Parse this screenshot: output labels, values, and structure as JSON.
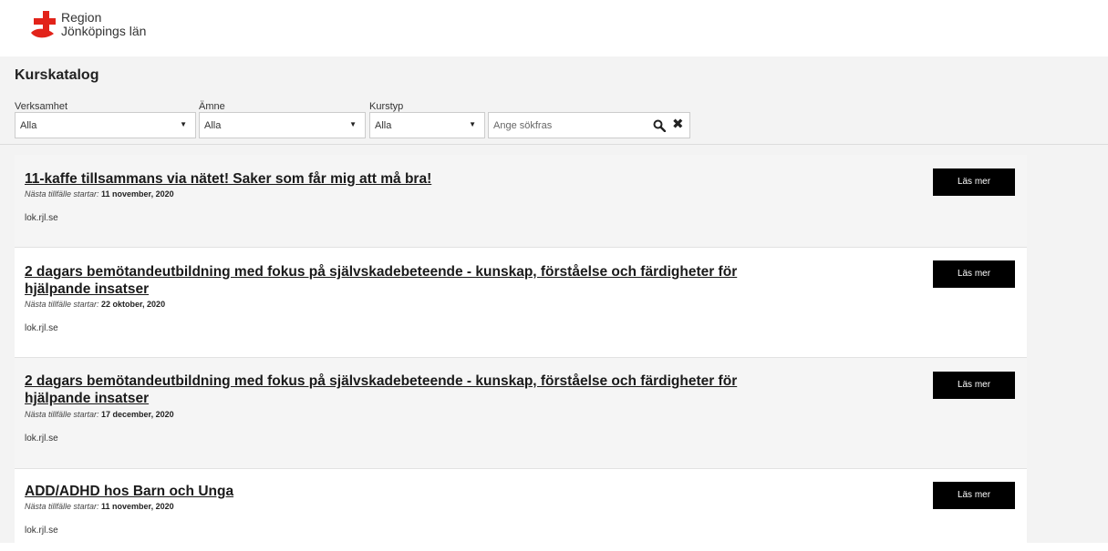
{
  "brand": {
    "line1": "Region",
    "line2": "Jönköpings län",
    "accent": "#e2231a"
  },
  "page_title": "Kurskatalog",
  "filters": [
    {
      "label": "Verksamhet",
      "value": "Alla"
    },
    {
      "label": "Ämne",
      "value": "Alla"
    },
    {
      "label": "Kurstyp",
      "value": "Alla"
    }
  ],
  "search": {
    "placeholder": "Ange sökfras",
    "search_icon": "search-icon",
    "clear_icon": "close-icon"
  },
  "courses": [
    {
      "title": "11-kaffe tillsammans via nätet! Saker som får mig att må bra!",
      "next_label": "Nästa tillfälle startar:",
      "next_date": "11 november, 2020",
      "source": "lok.rjl.se",
      "button": "Läs mer"
    },
    {
      "title": "2 dagars bemötandeutbildning med fokus på självskadebeteende - kunskap, förståelse och färdigheter för hjälpande insatser",
      "next_label": "Nästa tillfälle startar:",
      "next_date": "22 oktober, 2020",
      "source": "lok.rjl.se",
      "button": "Läs mer"
    },
    {
      "title": "2 dagars bemötandeutbildning med fokus på självskadebeteende - kunskap, förståelse och färdigheter för hjälpande insatser",
      "next_label": "Nästa tillfälle startar:",
      "next_date": "17 december, 2020",
      "source": "lok.rjl.se",
      "button": "Läs mer"
    },
    {
      "title": "ADD/ADHD hos Barn och Unga",
      "next_label": "Nästa tillfälle startar:",
      "next_date": "11 november, 2020",
      "source": "lok.rjl.se",
      "button": "Läs mer"
    }
  ]
}
